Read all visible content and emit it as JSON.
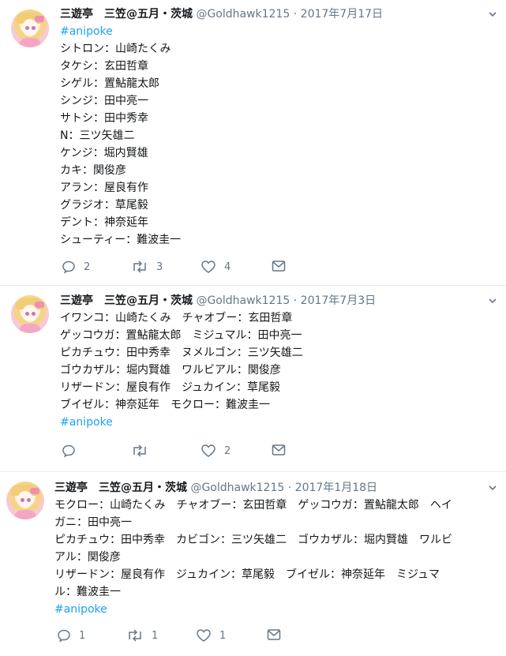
{
  "tweets": [
    {
      "name": "三遊亭　三笠@五月・茨城",
      "handle": "@Goldhawk1215",
      "sep": "·",
      "date": "2017年7月17日",
      "lines": [
        "#anipoke",
        "シトロン：山崎たくみ",
        "タケシ：玄田哲章",
        "シゲル：置鮎龍太郎",
        "シンジ：田中亮一",
        "サトシ：田中秀幸",
        "N：三ツ矢雄二",
        "ケンジ：堀内賢雄",
        "カキ：関俊彦",
        "アラン：屋良有作",
        "グラジオ：草尾毅",
        "デント：神奈延年",
        "シューティー：難波圭一"
      ],
      "hashtag_line_index": 0,
      "replies": "2",
      "retweets": "3",
      "likes": "4"
    },
    {
      "name": "三遊亭　三笠@五月・茨城",
      "handle": "@Goldhawk1215",
      "sep": "·",
      "date": "2017年7月3日",
      "lines": [
        "イワンコ：山崎たくみ　チャオブー：玄田哲章",
        "ゲッコウガ：置鮎龍太郎　ミジュマル：田中亮一",
        "ピカチュウ：田中秀幸　ヌメルゴン：三ツ矢雄二",
        "ゴウカザル：堀内賢雄　ワルビアル：関俊彦",
        "リザードン：屋良有作　ジュカイン：草尾毅",
        "ブイゼル：神奈延年　モクロー：難波圭一",
        "#anipoke"
      ],
      "hashtag_line_index": 6,
      "replies": "",
      "retweets": "",
      "likes": "2"
    },
    {
      "name": "三遊亭　三笠@五月・茨城",
      "handle": "@Goldhawk1215",
      "sep": "·",
      "date": "2017年1月18日",
      "lines": [
        "モクロー：山崎たくみ　チャオブー：玄田哲章　ゲッコウガ：置鮎龍太郎　ヘイ",
        "ガニ：田中亮一",
        "ピカチュウ：田中秀幸　カビゴン：三ツ矢雄二　ゴウカザル：堀内賢雄　ワルビ",
        "アル：関俊彦",
        "リザードン：屋良有作　ジュカイン：草尾毅　ブイゼル：神奈延年　ミジュマ",
        "ル：難波圭一",
        "#anipoke"
      ],
      "hashtag_line_index": 6,
      "replies": "1",
      "retweets": "1",
      "likes": "1"
    }
  ],
  "icons": [
    "reply-icon",
    "retweet-icon",
    "like-icon",
    "direct-message-icon",
    "chevron-down-icon",
    "avatar"
  ],
  "colors": {
    "link": "#1da1f2",
    "muted": "#657786",
    "text": "#14171a",
    "divider": "#e6ecf0"
  }
}
